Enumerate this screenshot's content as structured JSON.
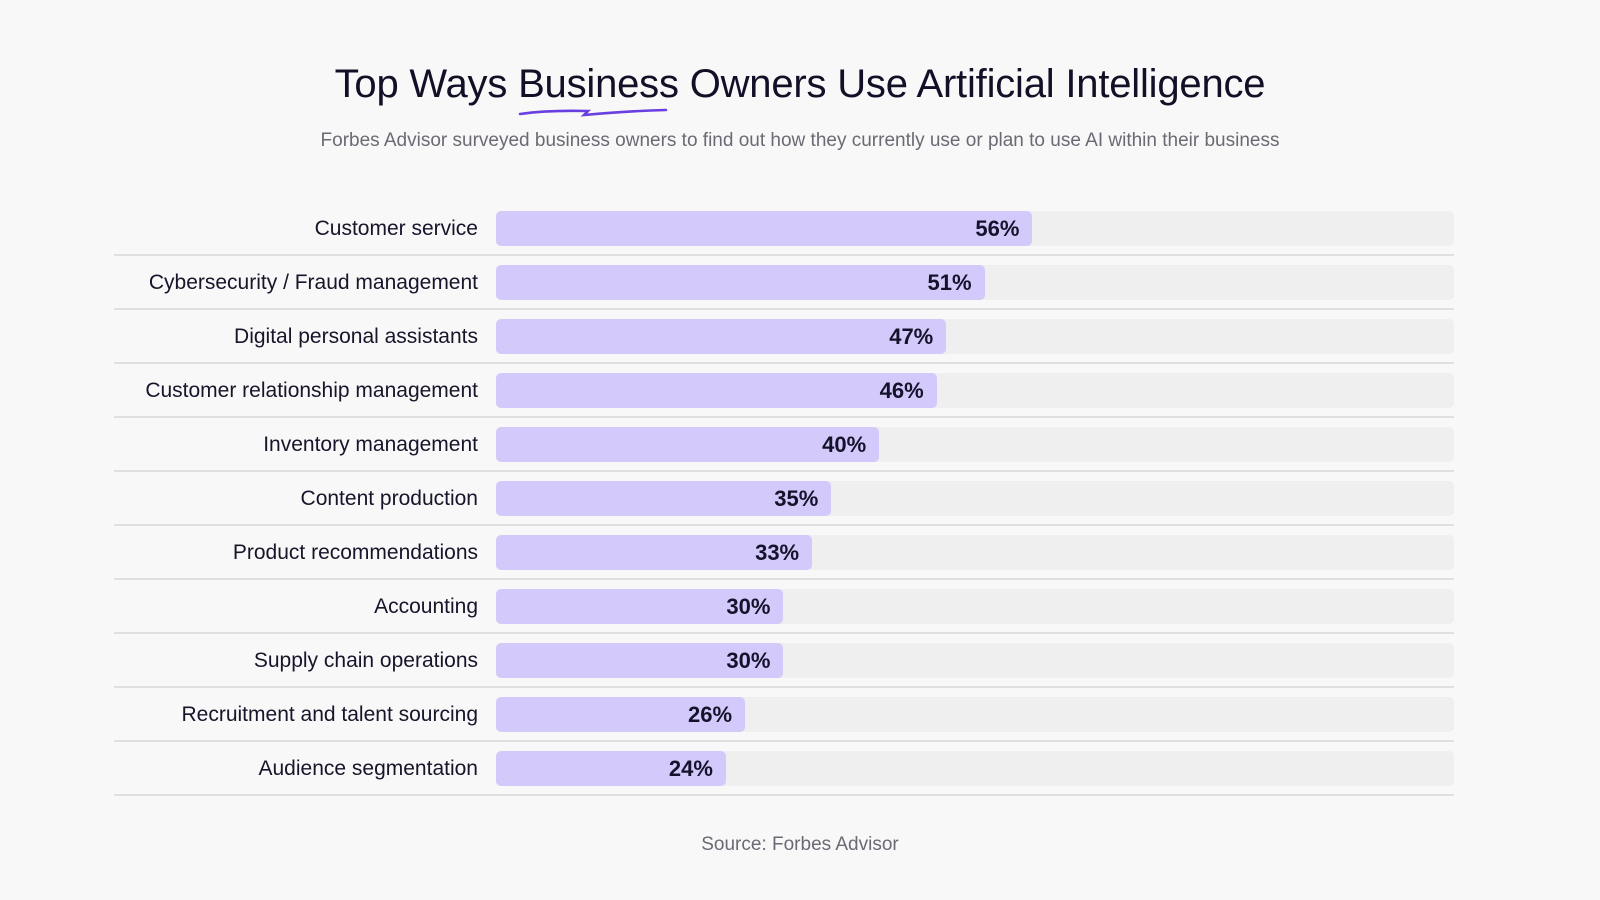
{
  "header": {
    "title_before": "Top Ways ",
    "title_highlight": "Business",
    "title_after": " Owners Use Artificial Intelligence",
    "subtitle": "Forbes Advisor surveyed business owners to find out how they currently use or plan to use AI within their business",
    "accent_color": "#6a3fe0"
  },
  "footer": {
    "source": "Source: Forbes Advisor"
  },
  "chart_data": {
    "type": "bar",
    "orientation": "horizontal",
    "title": "Top Ways Business Owners Use Artificial Intelligence",
    "subtitle": "Forbes Advisor surveyed business owners to find out how they currently use or plan to use AI within their business",
    "xlabel": "",
    "ylabel": "",
    "xlim": [
      0,
      100
    ],
    "unit": "%",
    "grid": false,
    "bar_color": "#d4c9fb",
    "track_color": "#efefef",
    "categories": [
      "Customer service",
      "Cybersecurity / Fraud management",
      "Digital personal assistants",
      "Customer relationship management",
      "Inventory management",
      "Content production",
      "Product recommendations",
      "Accounting",
      "Supply chain operations",
      "Recruitment and talent sourcing",
      "Audience segmentation"
    ],
    "values": [
      56,
      51,
      47,
      46,
      40,
      35,
      33,
      30,
      30,
      26,
      24
    ],
    "value_labels": [
      "56%",
      "51%",
      "47%",
      "46%",
      "40%",
      "35%",
      "33%",
      "30%",
      "30%",
      "26%",
      "24%"
    ],
    "source": "Source: Forbes Advisor"
  }
}
